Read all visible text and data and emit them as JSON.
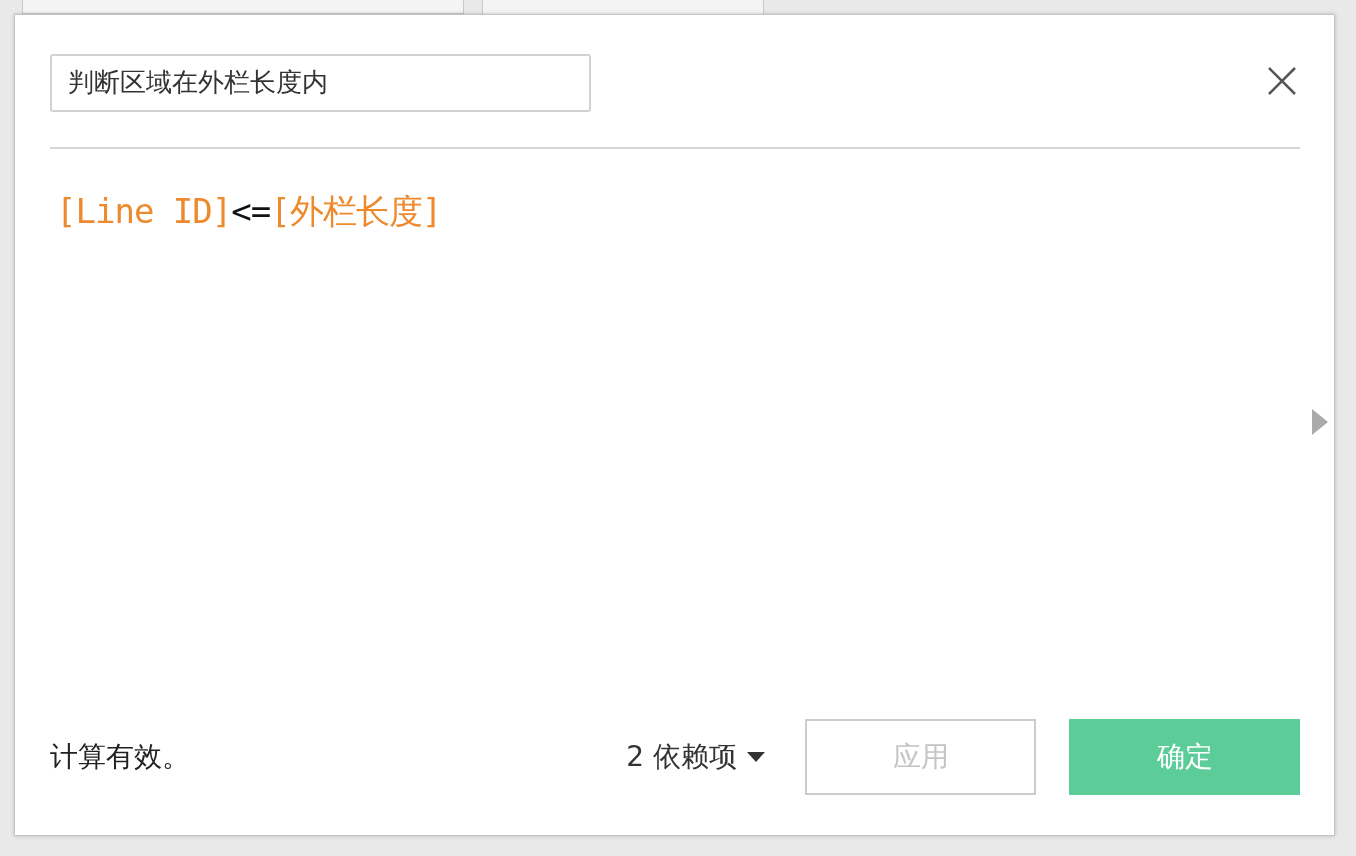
{
  "dialog": {
    "name_field": {
      "value": "判断区域在外栏长度内"
    },
    "formula": [
      {
        "kind": "field",
        "text": "[Line ID]"
      },
      {
        "kind": "operator",
        "text": "<="
      },
      {
        "kind": "field",
        "text": "[外栏长度]"
      }
    ],
    "status": "计算有效。",
    "dependencies": {
      "label": "2 依赖项"
    },
    "buttons": [
      {
        "label": "应用",
        "kind": "secondary",
        "disabled": true
      },
      {
        "label": "确定",
        "kind": "primary",
        "disabled": false
      }
    ]
  }
}
